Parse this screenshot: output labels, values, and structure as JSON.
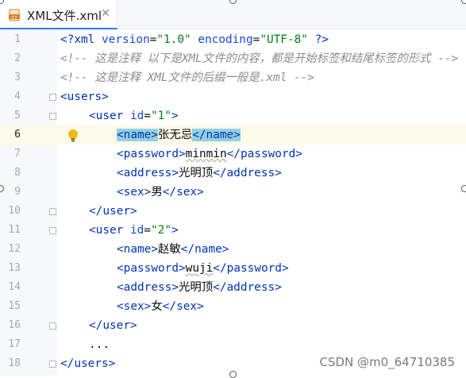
{
  "tab": {
    "title": "XML文件.xml",
    "close_glyph": "✕",
    "icon": "xml-file-icon"
  },
  "editor": {
    "current_line": 6,
    "lines": [
      {
        "n": "1"
      },
      {
        "n": "2"
      },
      {
        "n": "3"
      },
      {
        "n": "4"
      },
      {
        "n": "5"
      },
      {
        "n": "6"
      },
      {
        "n": "7"
      },
      {
        "n": "8"
      },
      {
        "n": "9"
      },
      {
        "n": "10"
      },
      {
        "n": "11"
      },
      {
        "n": "12"
      },
      {
        "n": "13"
      },
      {
        "n": "14"
      },
      {
        "n": "15"
      },
      {
        "n": "16"
      },
      {
        "n": "17"
      },
      {
        "n": "18"
      }
    ],
    "code": {
      "l1_open": "<?",
      "l1_xml": "xml",
      "l1_sp1": " ",
      "l1_attr1": "version",
      "l1_eq1": "=",
      "l1_val1": "\"1.0\"",
      "l1_sp2": " ",
      "l1_attr2": "encoding",
      "l1_eq2": "=",
      "l1_val2": "\"UTF-8\"",
      "l1_close": " ?>",
      "l2": "<!-- 这是注释 以下是XML文件的内容，都是开始标签和结尾标签的形式 -->",
      "l3": "<!-- 这是注释 XML文件的后缀一般是.xml -->",
      "l4_lt": "<",
      "l4_tag": "users",
      "l4_gt": ">",
      "l5_lt": "<",
      "l5_tag": "user",
      "l5_sp": " ",
      "l5_attr": "id",
      "l5_eq": "=",
      "l5_val": "\"1\"",
      "l5_gt": ">",
      "l6_open": "<name>",
      "l6_text": "张无忌",
      "l6_close": "</name>",
      "l7_open_lt": "<",
      "l7_open_tag": "password",
      "l7_open_gt": ">",
      "l7_text": "minmin",
      "l7_close_lt": "</",
      "l7_close_tag": "password",
      "l7_close_gt": ">",
      "l8_open_lt": "<",
      "l8_open_tag": "address",
      "l8_open_gt": ">",
      "l8_text": "光明顶",
      "l8_close_lt": "</",
      "l8_close_tag": "address",
      "l8_close_gt": ">",
      "l9_open_lt": "<",
      "l9_open_tag": "sex",
      "l9_open_gt": ">",
      "l9_text": "男",
      "l9_close_lt": "</",
      "l9_close_tag": "sex",
      "l9_close_gt": ">",
      "l10_lt": "</",
      "l10_tag": "user",
      "l10_gt": ">",
      "l11_lt": "<",
      "l11_tag": "user",
      "l11_sp": " ",
      "l11_attr": "id",
      "l11_eq": "=",
      "l11_val": "\"2\"",
      "l11_gt": ">",
      "l12_open_lt": "<",
      "l12_open_tag": "name",
      "l12_open_gt": ">",
      "l12_text": "赵敏",
      "l12_close_lt": "</",
      "l12_close_tag": "name",
      "l12_close_gt": ">",
      "l13_open_lt": "<",
      "l13_open_tag": "password",
      "l13_open_gt": ">",
      "l13_text": "wuji",
      "l13_close_lt": "</",
      "l13_close_tag": "password",
      "l13_close_gt": ">",
      "l14_open_lt": "<",
      "l14_open_tag": "address",
      "l14_open_gt": ">",
      "l14_text": "光明顶",
      "l14_close_lt": "</",
      "l14_close_tag": "address",
      "l14_close_gt": ">",
      "l15_open_lt": "<",
      "l15_open_tag": "sex",
      "l15_open_gt": ">",
      "l15_text": "女",
      "l15_close_lt": "</",
      "l15_close_tag": "sex",
      "l15_close_gt": ">",
      "l16_lt": "</",
      "l16_tag": "user",
      "l16_gt": ">",
      "l17": "...",
      "l18_lt": "</",
      "l18_tag": "users",
      "l18_gt": ">"
    }
  },
  "watermark": "CSDN @m0_64710385",
  "colors": {
    "tag": "#0033b3",
    "attr": "#174ad4",
    "string": "#067d17",
    "comment": "#8c8c8c",
    "highlight": "#94d0e3",
    "current_line": "#fcfae8"
  }
}
